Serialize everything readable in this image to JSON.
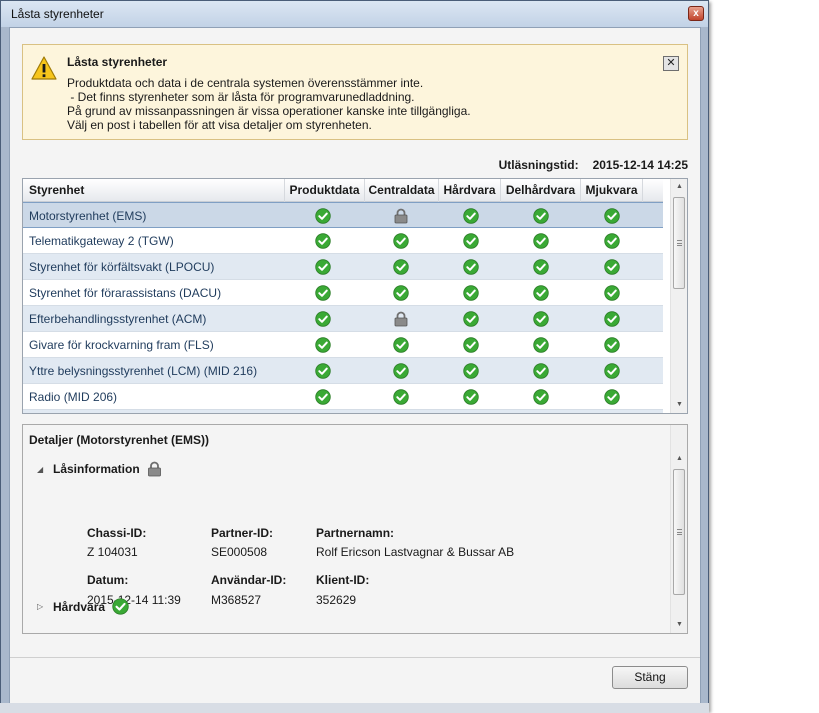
{
  "window": {
    "title": "Låsta styrenheter",
    "close_glyph": "x"
  },
  "notice": {
    "title": "Låsta styrenheter",
    "lines": [
      "Produktdata och data i de centrala systemen överensstämmer inte.",
      " - Det finns styrenheter som är låsta för programvarunedladdning.",
      "På grund av missanpassningen är vissa operationer kanske inte tillgängliga.",
      "Välj en post i tabellen för att visa detaljer om styrenheten."
    ],
    "close_glyph": "✕",
    "icon": "warning-icon"
  },
  "readout": {
    "label": "Utläsningstid:",
    "value": "2015-12-14 14:25"
  },
  "table": {
    "columns": [
      "Styrenhet",
      "Produktdata",
      "Centraldata",
      "Hårdvara",
      "Delhårdvara",
      "Mjukvara"
    ],
    "rows": [
      {
        "name": "Motorstyrenhet (EMS)",
        "status": [
          "ok",
          "lock",
          "ok",
          "ok",
          "ok"
        ],
        "selected": true
      },
      {
        "name": "Telematikgateway 2 (TGW)",
        "status": [
          "ok",
          "ok",
          "ok",
          "ok",
          "ok"
        ]
      },
      {
        "name": "Styrenhet för körfältsvakt (LPOCU)",
        "status": [
          "ok",
          "ok",
          "ok",
          "ok",
          "ok"
        ]
      },
      {
        "name": "Styrenhet för förarassistans (DACU)",
        "status": [
          "ok",
          "ok",
          "ok",
          "ok",
          "ok"
        ]
      },
      {
        "name": "Efterbehandlingsstyrenhet (ACM)",
        "status": [
          "ok",
          "lock",
          "ok",
          "ok",
          "ok"
        ]
      },
      {
        "name": "Givare för krockvarning fram (FLS)",
        "status": [
          "ok",
          "ok",
          "ok",
          "ok",
          "ok"
        ]
      },
      {
        "name": "Yttre belysningsstyrenhet (LCM) (MID 216)",
        "status": [
          "ok",
          "ok",
          "ok",
          "ok",
          "ok"
        ]
      },
      {
        "name": "Radio (MID 206)",
        "status": [
          "ok",
          "ok",
          "ok",
          "ok",
          "ok"
        ]
      },
      {
        "name": "",
        "status": [
          "ok",
          "ok",
          "ok",
          "ok",
          "ok"
        ]
      }
    ],
    "status_icons": {
      "ok": "check-circle-icon",
      "lock": "padlock-icon"
    },
    "colors": {
      "ok": "#3aa935",
      "lock": "#707070"
    }
  },
  "details": {
    "title": "Detaljer (Motorstyrenhet (EMS))",
    "lock_section": {
      "label": "Låsinformation",
      "expanded": true,
      "icon": "padlock-icon",
      "fields": [
        {
          "label": "Chassi-ID:",
          "value": "Z 104031"
        },
        {
          "label": "Partner-ID:",
          "value": "SE000508"
        },
        {
          "label": "Partnernamn:",
          "value": "Rolf Ericson Lastvagnar & Bussar AB"
        },
        {
          "label": "Datum:",
          "value": "2015-12-14 11:39"
        },
        {
          "label": "Användar-ID:",
          "value": "M368527"
        },
        {
          "label": "Klient-ID:",
          "value": "352629"
        }
      ]
    },
    "hardware_section": {
      "label": "Hårdvara",
      "expanded": false,
      "icon": "check-circle-icon"
    }
  },
  "footer": {
    "close_button": "Stäng"
  }
}
